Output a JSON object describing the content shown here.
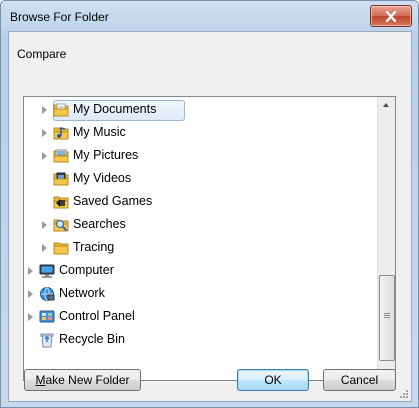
{
  "window": {
    "title": "Browse For Folder"
  },
  "caption": "Compare",
  "tree": [
    {
      "label": "My Documents",
      "icon": "documents-folder-icon",
      "expandable": true,
      "indent": 1,
      "selected": true
    },
    {
      "label": "My Music",
      "icon": "music-folder-icon",
      "expandable": true,
      "indent": 1
    },
    {
      "label": "My Pictures",
      "icon": "pictures-folder-icon",
      "expandable": true,
      "indent": 1
    },
    {
      "label": "My Videos",
      "icon": "videos-folder-icon",
      "expandable": false,
      "indent": 1
    },
    {
      "label": "Saved Games",
      "icon": "saved-games-folder-icon",
      "expandable": false,
      "indent": 1
    },
    {
      "label": "Searches",
      "icon": "searches-folder-icon",
      "expandable": true,
      "indent": 1
    },
    {
      "label": "Tracing",
      "icon": "folder-icon",
      "expandable": true,
      "indent": 1
    },
    {
      "label": "Computer",
      "icon": "computer-icon",
      "expandable": true,
      "indent": 0
    },
    {
      "label": "Network",
      "icon": "network-icon",
      "expandable": true,
      "indent": 0
    },
    {
      "label": "Control Panel",
      "icon": "control-panel-icon",
      "expandable": true,
      "indent": 0
    },
    {
      "label": "Recycle Bin",
      "icon": "recycle-bin-icon",
      "expandable": false,
      "indent": 0
    }
  ],
  "buttons": {
    "make_new_folder_prefix": "M",
    "make_new_folder_rest": "ake New Folder",
    "ok": "OK",
    "cancel": "Cancel"
  },
  "colors": {
    "selection_border": "#9ab8d9",
    "folder_yellow": "#e8b938",
    "close_red": "#c7503a"
  }
}
